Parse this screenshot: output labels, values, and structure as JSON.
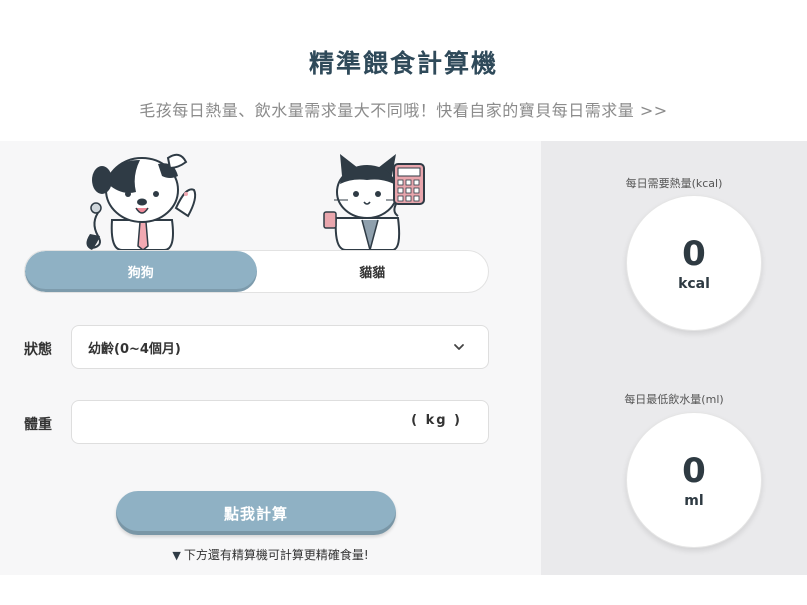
{
  "header": {
    "title": "精準餵食計算機",
    "subtitle": "毛孩每日熱量、飲水量需求量大不同哦！快看自家的寶貝每日需求量 >>"
  },
  "pet_toggle": {
    "dog_label": "狗狗",
    "cat_label": "貓貓",
    "selected": "狗狗"
  },
  "form": {
    "state_label": "狀態",
    "state_value": "幼齡(0~4個月)",
    "weight_label": "體重",
    "weight_value": "",
    "weight_unit": "( kg )"
  },
  "calc_button_label": "點我計算",
  "hint": {
    "marker": "▼",
    "text": "下方還有精算機可計算更精確食量!"
  },
  "results": {
    "kcal": {
      "label": "每日需要熱量(kcal)",
      "value": "0",
      "unit": "kcal"
    },
    "water": {
      "label": "每日最低飲水量(ml)",
      "value": "0",
      "unit": "ml"
    }
  },
  "colors": {
    "accent": "#8fb1c4",
    "title": "#2f4a5a",
    "left_panel_bg": "#f7f7f8",
    "right_panel_bg": "#eaeaec"
  },
  "icons": {
    "dog": "dog-doctor-illustration",
    "cat": "cat-calculator-illustration",
    "chevron": "chevron-down-icon"
  }
}
